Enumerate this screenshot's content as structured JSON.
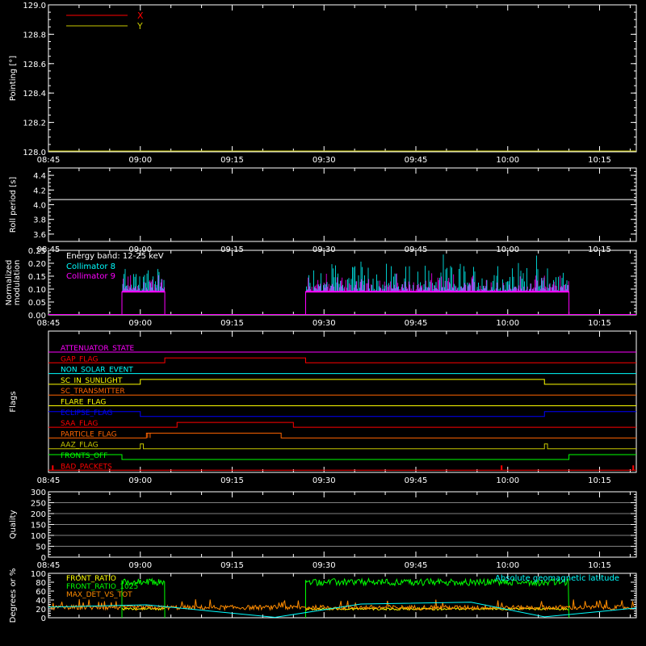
{
  "chart_data": [
    {
      "type": "line",
      "ylabel": "Pointing [°]",
      "ylim": [
        128.0,
        129.0
      ],
      "yticks": [
        "128.0",
        "128.2",
        "128.4",
        "128.6",
        "128.8",
        "129.0"
      ],
      "xticks": [
        "08:45",
        "09:00",
        "09:15",
        "09:30",
        "09:45",
        "10:00",
        "10:15"
      ],
      "legend": [
        {
          "name": "X",
          "color": "#ff0000"
        },
        {
          "name": "Y",
          "color": "#c8c800"
        }
      ],
      "series": [
        {
          "name": "X",
          "color": "#ff0000",
          "values": []
        },
        {
          "name": "Y",
          "color": "#c8c800",
          "values": []
        }
      ]
    },
    {
      "type": "line",
      "ylabel": "Roll period [s]",
      "ylim": [
        3.5,
        4.5
      ],
      "yticks": [
        "3.6",
        "3.8",
        "4.0",
        "4.2",
        "4.4"
      ],
      "xticks": [
        "08:45",
        "09:00",
        "09:15",
        "09:30",
        "09:45",
        "10:00",
        "10:15"
      ],
      "series": [
        {
          "color": "#ffffff",
          "constant": 4.07
        }
      ]
    },
    {
      "type": "line",
      "ylabel": "Normalized modulation",
      "ylim": [
        0.0,
        0.25
      ],
      "yticks": [
        "0.00",
        "0.05",
        "0.10",
        "0.15",
        "0.20",
        "0.25"
      ],
      "xticks": [
        "08:45",
        "09:00",
        "09:15",
        "09:30",
        "09:45",
        "10:00",
        "10:15"
      ],
      "annotation": "Energy band: 12-25 keV",
      "legend": [
        {
          "name": "Collimator 8",
          "color": "#00ffff"
        },
        {
          "name": "Collimator 9",
          "color": "#ff00ff"
        }
      ],
      "segments": [
        {
          "start": "08:57",
          "end": "09:04",
          "base": 0.09
        },
        {
          "start": "09:27",
          "end": "10:10",
          "base": 0.09
        }
      ]
    },
    {
      "type": "table",
      "ylabel": "Flags",
      "xticks": [
        "08:45",
        "09:00",
        "09:15",
        "09:30",
        "09:45",
        "10:00",
        "10:15"
      ],
      "flags": [
        {
          "name": "ATTENUATOR_STATE",
          "color": "#ff00ff",
          "high": []
        },
        {
          "name": "GAP_FLAG",
          "color": "#ff0000",
          "high": [
            [
              "09:04",
              "09:27"
            ]
          ]
        },
        {
          "name": "NON_SOLAR_EVENT",
          "color": "#00ffff",
          "high": []
        },
        {
          "name": "SC_IN_SUNLIGHT",
          "color": "#ffff00",
          "high": [
            [
              "09:00",
              "10:06"
            ]
          ]
        },
        {
          "name": "SC_TRANSMITTER",
          "color": "#ff6400",
          "high": []
        },
        {
          "name": "FLARE_FLAG",
          "color": "#ffff00",
          "high": []
        },
        {
          "name": "ECLIPSE_FLAG",
          "color": "#0000ff",
          "high": [
            [
              "08:45",
              "09:00"
            ],
            [
              "10:06",
              "10:21"
            ]
          ]
        },
        {
          "name": "SAA_FLAG",
          "color": "#ff0000",
          "high": [
            [
              "09:06",
              "09:25"
            ]
          ]
        },
        {
          "name": "PARTICLE_FLAG",
          "color": "#ff6400",
          "high": [
            [
              "09:01",
              "09:23"
            ]
          ]
        },
        {
          "name": "AAZ_FLAG",
          "color": "#c8c800",
          "high": [
            [
              "09:00",
              "09:00.5"
            ],
            [
              "10:06",
              "10:06.5"
            ]
          ]
        },
        {
          "name": "FRONTS_OFF",
          "color": "#00ff00",
          "high": [
            [
              "08:45",
              "08:57"
            ],
            [
              "10:10",
              "10:21"
            ]
          ]
        },
        {
          "name": "BAD_PACKETS",
          "color": "#ff0000",
          "high": []
        }
      ]
    },
    {
      "type": "line",
      "ylabel": "Quality",
      "ylim": [
        0,
        300
      ],
      "yticks": [
        "0",
        "50",
        "100",
        "150",
        "200",
        "250",
        "300"
      ],
      "xticks": [
        "08:45",
        "09:00",
        "09:15",
        "09:30",
        "09:45",
        "10:00",
        "10:15"
      ],
      "series": []
    },
    {
      "type": "line",
      "ylabel": "Degrees or %",
      "ylim": [
        0,
        100
      ],
      "yticks": [
        "0",
        "20",
        "40",
        "60",
        "80",
        "100"
      ],
      "xticks": [
        "08:45",
        "09:00",
        "09:15",
        "09:30",
        "09:45",
        "10:00",
        "10:15"
      ],
      "legend": [
        {
          "name": "FRONT_RATIO",
          "color": "#ffff00"
        },
        {
          "name": "FRONT_RATIO_1025",
          "color": "#00ff00"
        },
        {
          "name": "MAX_DET_VS_TOT",
          "color": "#ff8c00"
        }
      ],
      "annotation": "Absolute geomagnetic latitude",
      "annotation_color": "#00ffff",
      "segments": [
        {
          "start": "08:57",
          "end": "09:04"
        },
        {
          "start": "09:27",
          "end": "10:10"
        }
      ],
      "front_ratio_1025_level": 80,
      "max_det_level": 22,
      "latitude": {
        "x": [
          "08:45",
          "09:01",
          "09:22",
          "09:36",
          "09:54",
          "10:06",
          "10:21"
        ],
        "y": [
          24,
          29,
          1,
          31,
          35,
          2,
          22
        ]
      }
    }
  ]
}
